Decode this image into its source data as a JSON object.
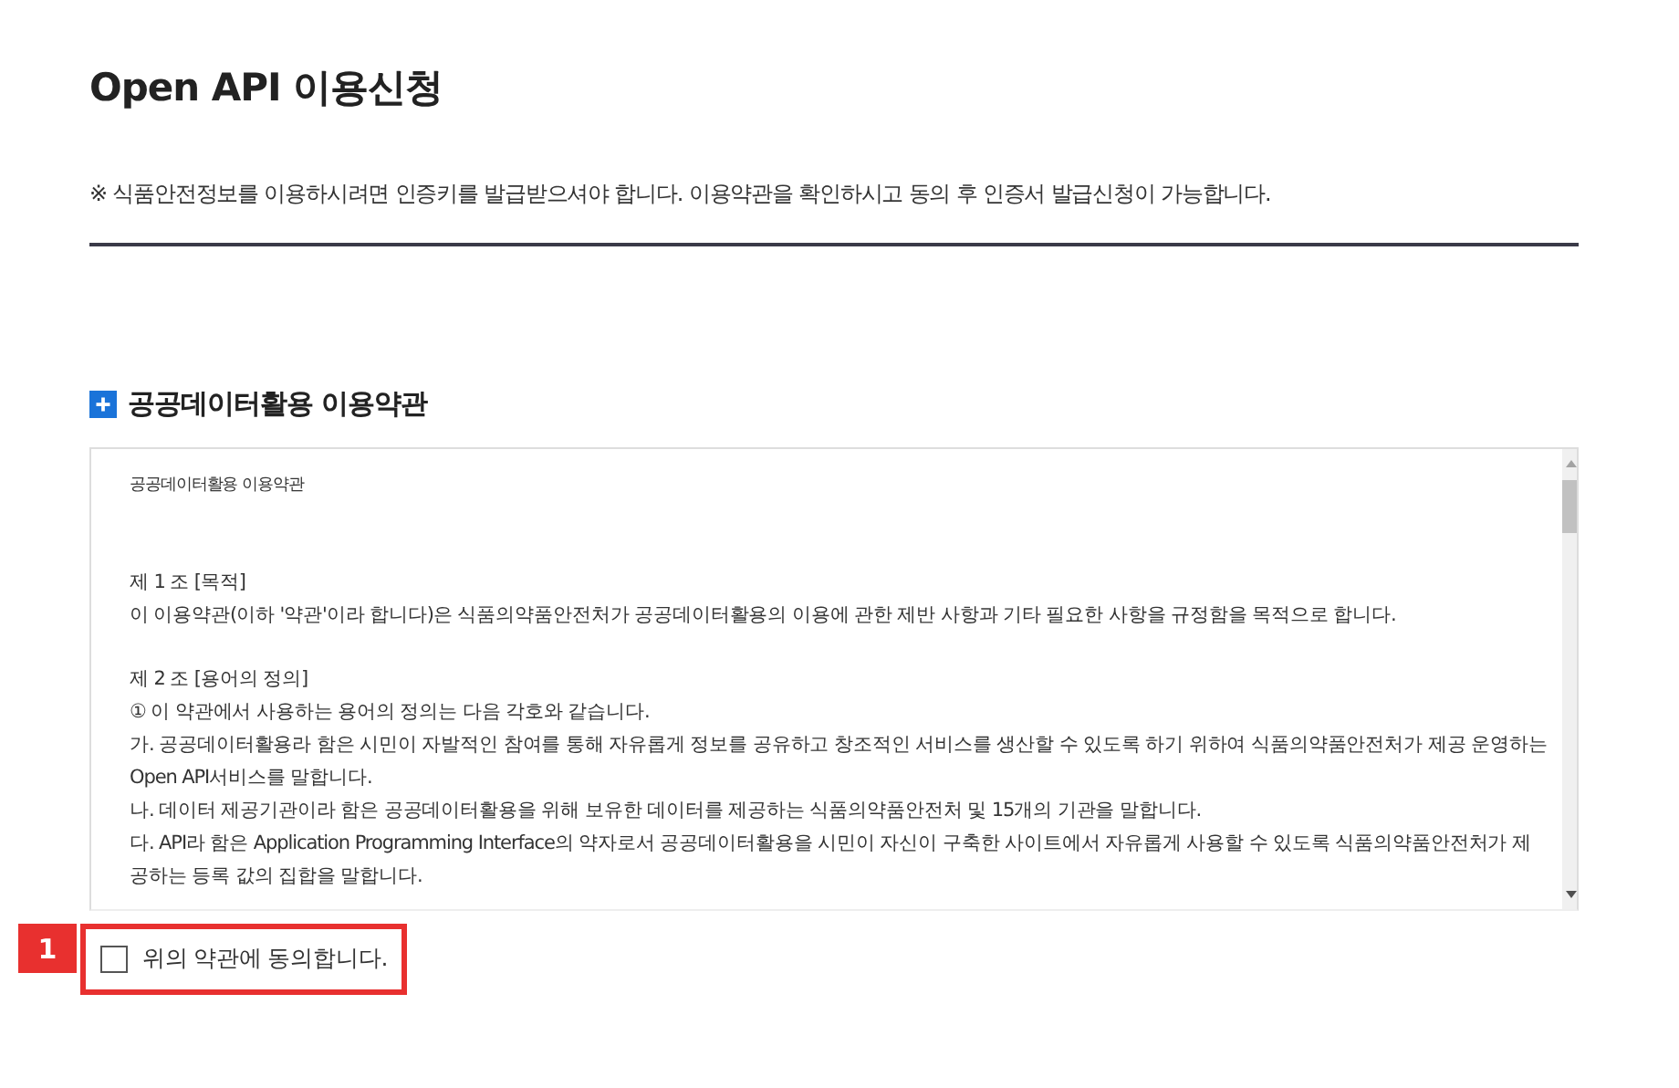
{
  "page_title": "Open API 이용신청",
  "notice": "※ 식품안전정보를 이용하시려면 인증키를 발급받으셔야 합니다. 이용약관을 확인하시고 동의 후 인증서 발급신청이 가능합니다.",
  "section": {
    "title": "공공데이터활용 이용약관"
  },
  "terms": {
    "title": "공공데이터활용 이용약관",
    "articles": [
      {
        "heading": "제 1 조 [목적]",
        "lines": [
          "이 이용약관(이하 '약관'이라 합니다)은 식품의약품안전처가 공공데이터활용의 이용에 관한 제반 사항과 기타 필요한 사항을 규정함을 목적으로 합니다."
        ]
      },
      {
        "heading": "제 2 조 [용어의 정의]",
        "lines": [
          "① 이 약관에서 사용하는 용어의 정의는 다음 각호와 같습니다.",
          "가. 공공데이터활용라 함은 시민이 자발적인 참여를 통해 자유롭게 정보를 공유하고 창조적인 서비스를 생산할 수 있도록 하기 위하여 식품의약품안전처가 제공 운영하는",
          "Open API서비스를 말합니다.",
          "나. 데이터 제공기관이라 함은 공공데이터활용을 위해 보유한 데이터를 제공하는 식품의약품안전처 및 15개의 기관을 말합니다.",
          "다. API라 함은 Application Programming Interface의 약자로서 공공데이터활용을 시민이 자신이 구축한 사이트에서 자유롭게 사용할 수 있도록 식품의약품안전처가 제",
          "공하는 등록 값의 집합을 말합니다."
        ]
      }
    ]
  },
  "agree": {
    "label": "위의 약관에 동의합니다.",
    "checked": false
  },
  "annotation": {
    "number": "1"
  }
}
